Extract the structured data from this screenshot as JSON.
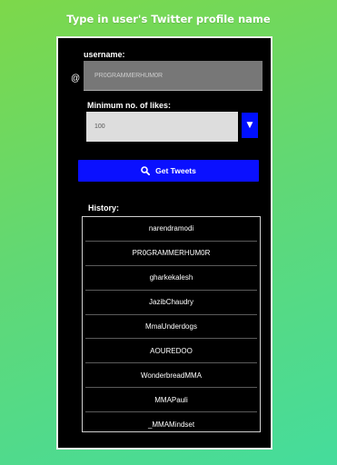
{
  "header": {
    "title": "Type in user's Twitter profile name"
  },
  "username": {
    "label": "username:",
    "prefix": "@",
    "value": "PR0GRAMMERHUM0R"
  },
  "likes": {
    "label": "Minimum no. of likes:",
    "value": "100",
    "dropdown_icon": "triangle-down-icon"
  },
  "get_button": {
    "label": "Get Tweets",
    "icon": "search-icon"
  },
  "history": {
    "label": "History:",
    "items": [
      "narendramodi",
      "PR0GRAMMERHUM0R",
      "gharkekalesh",
      "JazibChaudry",
      "MmaUnderdogs",
      "AOUREDOO",
      "WonderbreadMMA",
      "MMAPauli",
      "_MMAMindset"
    ]
  },
  "colors": {
    "accent_blue": "#0a10ff",
    "background_start": "#7dd84a",
    "background_end": "#45dc9c"
  }
}
